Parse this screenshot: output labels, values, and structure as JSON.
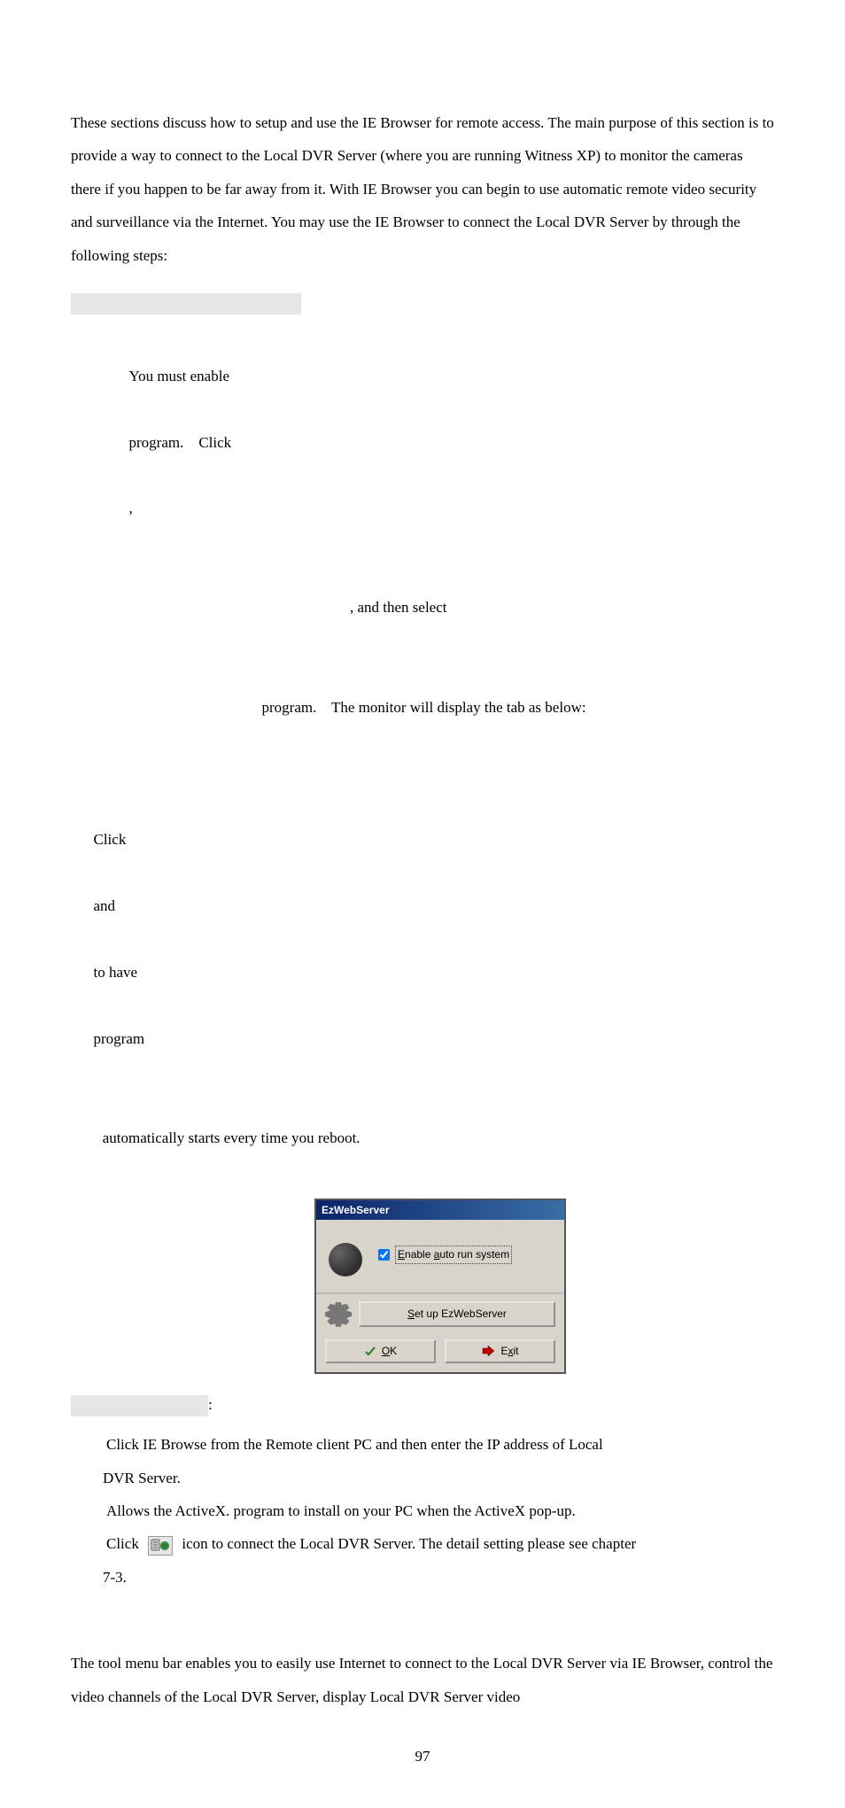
{
  "intro": "These sections discuss how to setup and use the IE Browser for remote access.    The main purpose of this section is to provide a way to connect to the Local DVR Server (where you are running Witness XP) to monitor the cameras there if you happen to be far away from it.    With IE Browser you can begin to use automatic remote video security and surveillance via the Internet. You may use the IE Browser to connect the Local DVR Server by through the following steps:",
  "local": {
    "line1_a": "You must enable",
    "line1_b": "program.    Click",
    "line1_c": ",",
    "line2_a": ", and then select",
    "line3_a": "program.    The monitor will display the tab as below:",
    "line4_a": "Click",
    "line4_b": "and",
    "line4_c": "to have",
    "line4_d": "program",
    "line5": " automatically starts every time you reboot."
  },
  "dialog": {
    "title": "EzWebServer",
    "checkbox": "Enable auto run system",
    "checkbox_prefix": "E",
    "setup": "Set up EzWebServer",
    "setup_underline": "S",
    "ok": "OK",
    "ok_underline": "O",
    "exit": "Exit",
    "exit_underline": "x"
  },
  "remote": {
    "colon": ":",
    "step1": "Click IE Browse from the Remote client PC and then enter the IP address of Local",
    "step1b": " DVR Server.",
    "step2": "Allows the ActiveX. program to install on your PC when the ActiveX pop-up.",
    "step3a": "Click ",
    "step3b": " icon to connect the Local DVR Server.    The detail setting please see chapter",
    "step3c": " 7-3."
  },
  "bottom": "The tool menu bar enables you to easily use Internet to connect to the Local DVR Server via IE Browser, control the video channels of the Local DVR Server, display Local DVR Server video",
  "page_number": "97"
}
